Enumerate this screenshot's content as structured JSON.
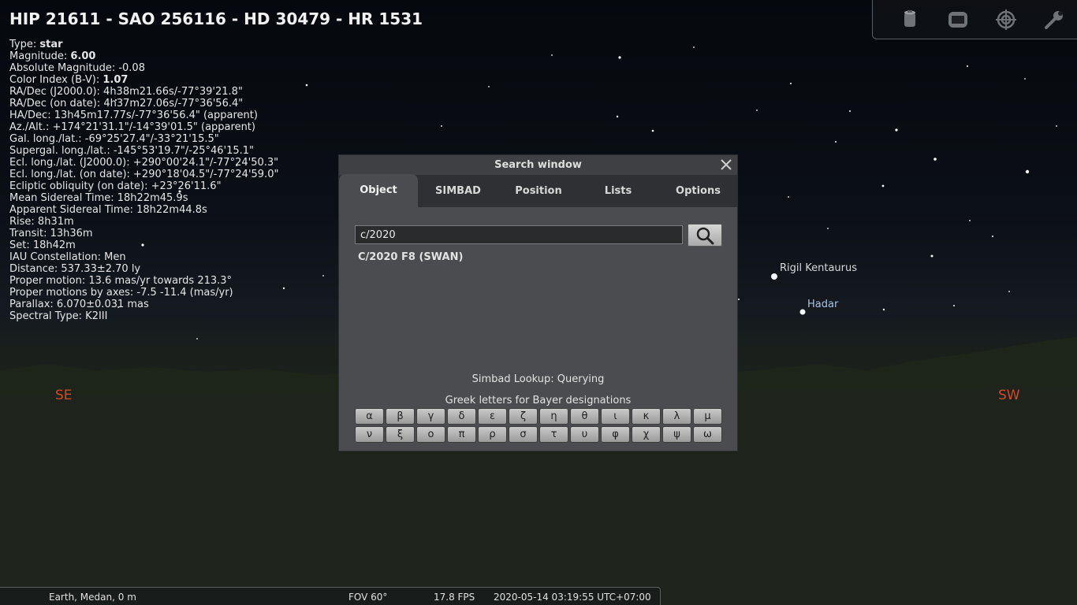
{
  "object_info": {
    "title": "HIP 21611 - SAO 256116 - HD 30479 - HR 1531",
    "lines": [
      {
        "label": "Type: ",
        "value": "star",
        "bold": true
      },
      {
        "label": "Magnitude: ",
        "value": "6.00",
        "bold": true
      },
      {
        "label": "Absolute Magnitude: -0.08",
        "value": "",
        "bold": false
      },
      {
        "label": "Color Index (B-V): ",
        "value": "1.07",
        "bold": true
      },
      {
        "label": "RA/Dec (J2000.0): 4h38m21.66s/-77°39'21.8\"",
        "value": "",
        "bold": false
      },
      {
        "label": "RA/Dec (on date): 4h37m27.06s/-77°36'56.4\"",
        "value": "",
        "bold": false
      },
      {
        "label": "HA/Dec: 13h45m17.77s/-77°36'56.4\" (apparent)",
        "value": "",
        "bold": false
      },
      {
        "label": "Az./Alt.: +174°21'31.1\"/-14°39'01.5\" (apparent)",
        "value": "",
        "bold": false
      },
      {
        "label": "Gal. long./lat.: -69°25'27.4\"/-33°21'15.5\"",
        "value": "",
        "bold": false
      },
      {
        "label": "Supergal. long./lat.: -145°53'19.7\"/-25°46'15.1\"",
        "value": "",
        "bold": false
      },
      {
        "label": "Ecl. long./lat. (J2000.0): +290°00'24.1\"/-77°24'50.3\"",
        "value": "",
        "bold": false
      },
      {
        "label": "Ecl. long./lat. (on date): +290°18'04.5\"/-77°24'59.0\"",
        "value": "",
        "bold": false
      },
      {
        "label": "Ecliptic obliquity (on date): +23°26'11.6\"",
        "value": "",
        "bold": false
      },
      {
        "label": "Mean Sidereal Time: 18h22m45.9s",
        "value": "",
        "bold": false
      },
      {
        "label": "Apparent Sidereal Time: 18h22m44.8s",
        "value": "",
        "bold": false
      },
      {
        "label": "Rise: 8h31m",
        "value": "",
        "bold": false
      },
      {
        "label": "Transit: 13h36m",
        "value": "",
        "bold": false
      },
      {
        "label": "Set: 18h42m",
        "value": "",
        "bold": false
      },
      {
        "label": "IAU Constellation: Men",
        "value": "",
        "bold": false
      },
      {
        "label": "Distance: 537.33±2.70 ly",
        "value": "",
        "bold": false
      },
      {
        "label": "Proper motion: 13.6 mas/yr towards 213.3°",
        "value": "",
        "bold": false
      },
      {
        "label": "Proper motions by axes: -7.5 -11.4 (mas/yr)",
        "value": "",
        "bold": false
      },
      {
        "label": "Parallax: 6.070±0.031 mas",
        "value": "",
        "bold": false
      },
      {
        "label": "Spectral Type: K2III",
        "value": "",
        "bold": false
      }
    ]
  },
  "compass": {
    "se": "SE",
    "sw": "SW"
  },
  "sky_labels": {
    "rigil": "Rigil Kentaurus",
    "hadar": "Hadar"
  },
  "toolbar": {
    "icons": [
      "telescope-icon",
      "screen-icon",
      "target-icon",
      "wrench-icon"
    ]
  },
  "search_window": {
    "title": "Search window",
    "tabs": [
      "Object",
      "SIMBAD",
      "Position",
      "Lists",
      "Options"
    ],
    "active_tab": "Object",
    "input_value": "c/2020",
    "results": [
      "C/2020 F8 (SWAN)"
    ],
    "status": "Simbad Lookup: Querying",
    "greek_title": "Greek letters for Bayer designations",
    "greek_letters": [
      "α",
      "β",
      "γ",
      "δ",
      "ε",
      "ζ",
      "η",
      "θ",
      "ι",
      "κ",
      "λ",
      "μ",
      "ν",
      "ξ",
      "ο",
      "π",
      "ρ",
      "σ",
      "τ",
      "υ",
      "φ",
      "χ",
      "ψ",
      "ω"
    ]
  },
  "bottom_bar": {
    "location": "Earth, Medan, 0 m",
    "fov": "FOV 60°",
    "fps": "17.8 FPS",
    "datetime": "2020-05-14 03:19:55 UTC+07:00"
  },
  "colors": {
    "compass": "#d04a2a",
    "rigil_label": "#d8d8d8",
    "hadar_label": "#a9c4e8"
  }
}
